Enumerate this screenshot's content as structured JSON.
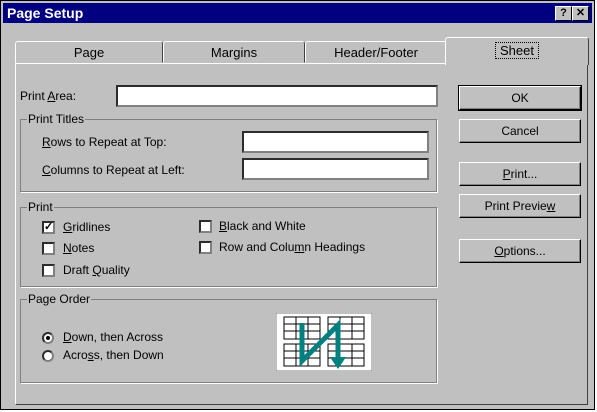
{
  "window": {
    "title": "Page Setup",
    "help_glyph": "?",
    "close_glyph": "✕"
  },
  "tabs": [
    {
      "label": "Page"
    },
    {
      "label": "Margins"
    },
    {
      "label": "Header/Footer"
    },
    {
      "label": "Sheet",
      "active": true
    }
  ],
  "print_area": {
    "label_before": "Print ",
    "label_accel": "A",
    "label_after": "rea:",
    "value": ""
  },
  "print_titles": {
    "legend": "Print Titles",
    "rows": {
      "accel": "R",
      "rest": "ows to Repeat at Top:",
      "value": ""
    },
    "columns": {
      "accel": "C",
      "rest": "olumns to Repeat at Left:",
      "value": ""
    }
  },
  "print": {
    "legend": "Print",
    "gridlines": {
      "accel": "G",
      "rest": "ridlines",
      "checked": true
    },
    "notes": {
      "accel": "N",
      "rest": "otes",
      "checked": false
    },
    "draft": {
      "before": "Draft ",
      "accel": "Q",
      "rest": "uality",
      "checked": false
    },
    "bw": {
      "accel": "B",
      "rest": "lack and White",
      "checked": false
    },
    "headings": {
      "before": "Row and Colu",
      "accel": "m",
      "rest": "n Headings",
      "checked": false
    }
  },
  "page_order": {
    "legend": "Page Order",
    "down": {
      "accel": "D",
      "rest": "own, then Across",
      "selected": true
    },
    "across": {
      "before": "Acro",
      "accel": "s",
      "rest": "s, then Down",
      "selected": false
    }
  },
  "buttons": {
    "ok": "OK",
    "cancel": "Cancel",
    "print": {
      "accel": "P",
      "rest": "rint..."
    },
    "preview": {
      "before": "Print Previe",
      "accel": "w"
    },
    "options": {
      "accel": "O",
      "rest": "ptions..."
    }
  },
  "colors": {
    "title_bar": "#000080",
    "face": "#c0c0c0",
    "arrow": "#008080"
  },
  "icons": {
    "page_order_preview": "page-order-down-then-across-icon"
  }
}
